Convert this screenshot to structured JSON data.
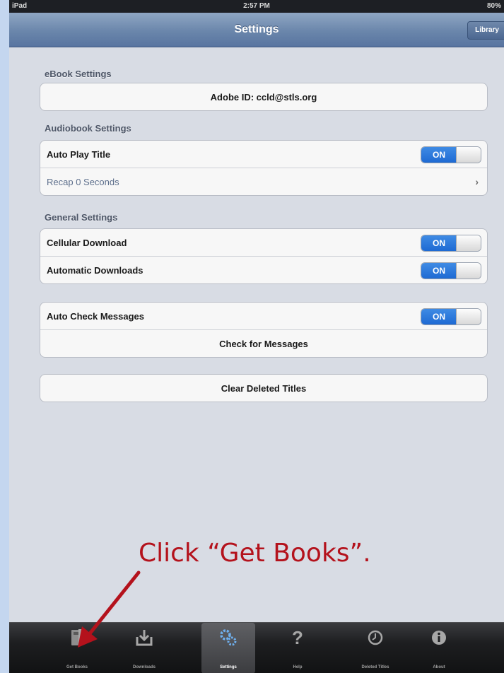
{
  "status_bar": {
    "device": "iPad",
    "time": "2:57 PM",
    "battery": "80%"
  },
  "navbar": {
    "title": "Settings",
    "right_button": "Library"
  },
  "sections": {
    "ebook": {
      "header": "eBook Settings",
      "adobe_id": "Adobe ID: ccld@stls.org"
    },
    "audiobook": {
      "header": "Audiobook Settings",
      "auto_play_label": "Auto Play Title",
      "auto_play_state": "ON",
      "recap_label": "Recap 0 Seconds"
    },
    "general": {
      "header": "General Settings",
      "cellular_label": "Cellular Download",
      "cellular_state": "ON",
      "automatic_label": "Automatic Downloads",
      "automatic_state": "ON"
    },
    "messages": {
      "auto_check_label": "Auto Check Messages",
      "auto_check_state": "ON",
      "check_button": "Check for Messages"
    },
    "deleted": {
      "clear_button": "Clear Deleted Titles"
    }
  },
  "annotation": {
    "text": "Click “Get Books”."
  },
  "tabbar": {
    "tabs": [
      {
        "label": "Get Books",
        "icon": "get-books-icon",
        "selected": false
      },
      {
        "label": "Downloads",
        "icon": "download-icon",
        "selected": false
      },
      {
        "label": "Settings",
        "icon": "gear-icon",
        "selected": true
      },
      {
        "label": "Help",
        "icon": "question-icon",
        "selected": false
      },
      {
        "label": "Deleted Titles",
        "icon": "clock-icon",
        "selected": false
      },
      {
        "label": "About",
        "icon": "info-icon",
        "selected": false
      }
    ]
  },
  "colors": {
    "annotation_red": "#b4121c",
    "toggle_blue": "#1e6ad3",
    "nav_blue": "#6a86ab"
  }
}
